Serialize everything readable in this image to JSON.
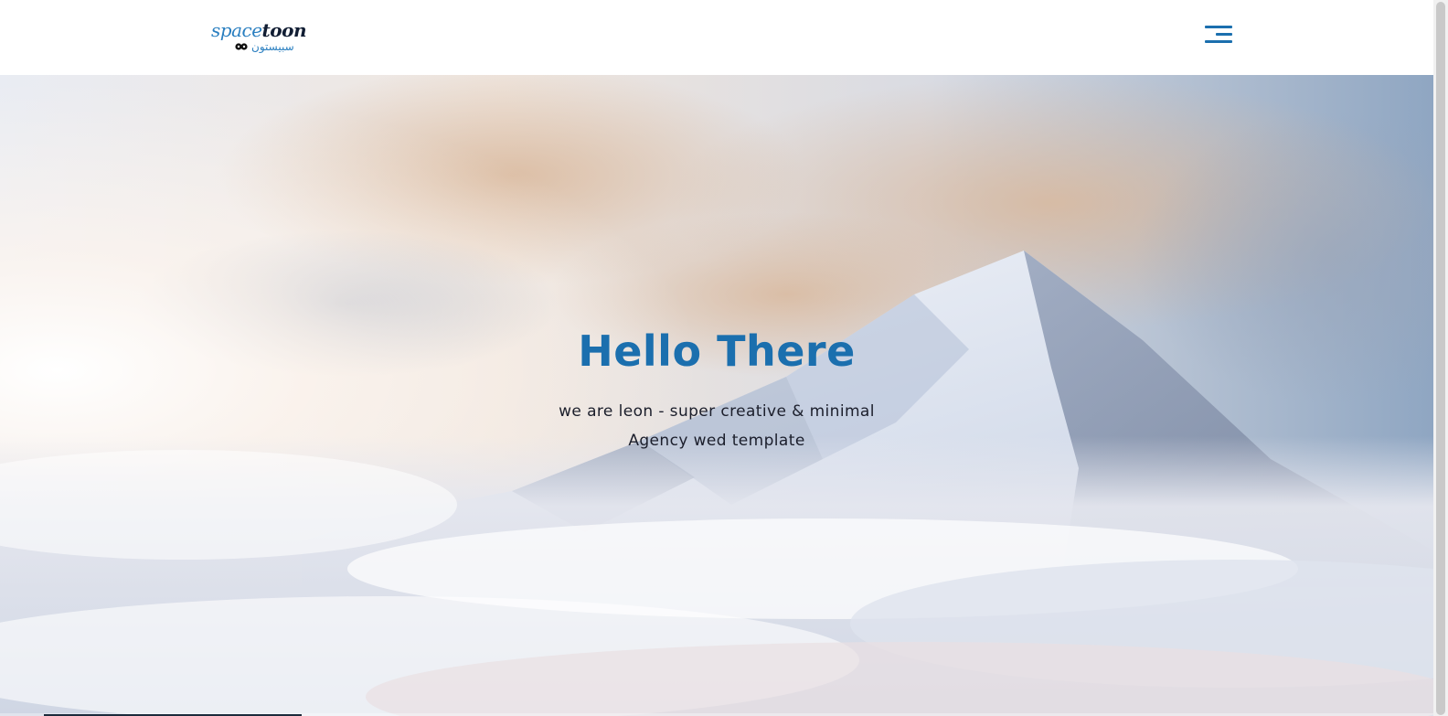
{
  "header": {
    "logo": {
      "word_part1": "space",
      "word_part2": "toon",
      "arabic": "سبيستون"
    },
    "menu_icon": "hamburger-menu-icon"
  },
  "hero": {
    "title": "Hello There",
    "subtitle": "we are leon - super creative & minimal Agency wed template",
    "background": "snowy-mountain-peak-above-clouds"
  },
  "slider": {
    "progress": 0.18
  },
  "colors": {
    "accent": "#1b6fae",
    "text_dark": "#1b1e2b",
    "header_bg": "#ffffff"
  }
}
